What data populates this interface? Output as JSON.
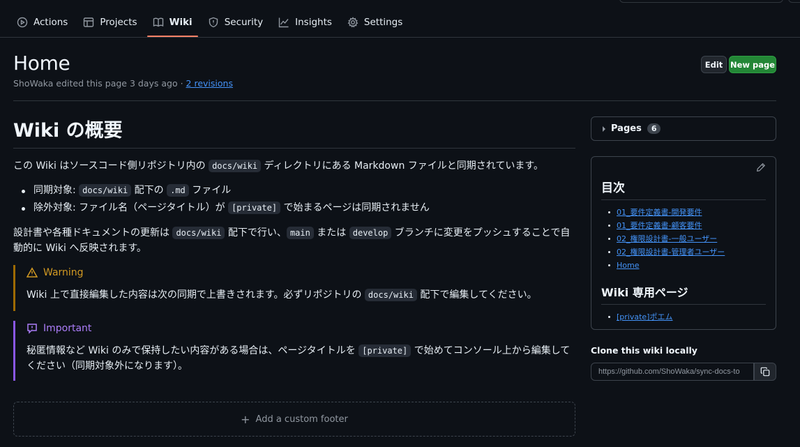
{
  "nav": {
    "tabs": [
      {
        "label": "Actions",
        "icon": "play-icon"
      },
      {
        "label": "Projects",
        "icon": "table-icon"
      },
      {
        "label": "Wiki",
        "icon": "book-icon",
        "active": true
      },
      {
        "label": "Security",
        "icon": "shield-icon"
      },
      {
        "label": "Insights",
        "icon": "graph-icon"
      },
      {
        "label": "Settings",
        "icon": "gear-icon"
      }
    ]
  },
  "header": {
    "title": "Home",
    "meta_prefix": "ShoWaka edited this page 3 days ago · ",
    "revisions_link": "2 revisions",
    "edit_label": "Edit",
    "new_page_label": "New page"
  },
  "content": {
    "heading": "Wiki の概要",
    "intro": {
      "before": "この Wiki はソースコード側リポジトリ内の ",
      "code": "docs/wiki",
      "after": " ディレクトリにある Markdown ファイルと同期されています。"
    },
    "bullets": [
      {
        "before": "同期対象: ",
        "code": "docs/wiki",
        "middle": " 配下の ",
        "code2": ".md",
        "after": " ファイル"
      },
      {
        "before": "除外対象: ファイル名（ページタイトル）が ",
        "code": "[private]",
        "after": " で始まるページは同期されません"
      }
    ],
    "update": {
      "t1": "設計書や各種ドキュメントの更新は ",
      "c1": "docs/wiki",
      "t2": " 配下で行い、",
      "c2": "main",
      "t3": " または ",
      "c3": "develop",
      "t4": " ブランチに変更をプッシュすることで自動的に Wiki へ反映されます。"
    },
    "warning": {
      "title": "Warning",
      "before": "Wiki 上で直接編集した内容は次の同期で上書きされます。必ずリポジトリの ",
      "code": "docs/wiki",
      "after": " 配下で編集してください。"
    },
    "important": {
      "title": "Important",
      "before": "秘匿情報など Wiki のみで保持したい内容がある場合は、ページタイトルを ",
      "code": "[private]",
      "after": " で始めてコンソール上から編集してください（同期対象外になります）。"
    },
    "footer_label": "Add a custom footer"
  },
  "sidebar": {
    "pages_label": "Pages",
    "pages_count": "6",
    "toc_title": "目次",
    "toc_items": [
      "01_要件定義書-開発要件",
      "01_要件定義書-顧客要件",
      "02_権限設計書-一般ユーザー",
      "02_権限設計書-管理者ユーザー",
      "Home"
    ],
    "special_title": "Wiki 専用ページ",
    "special_items": [
      "[private]ポエム"
    ],
    "clone_label": "Clone this wiki locally",
    "clone_url": "https://github.com/ShoWaka/sync-docs-to"
  }
}
